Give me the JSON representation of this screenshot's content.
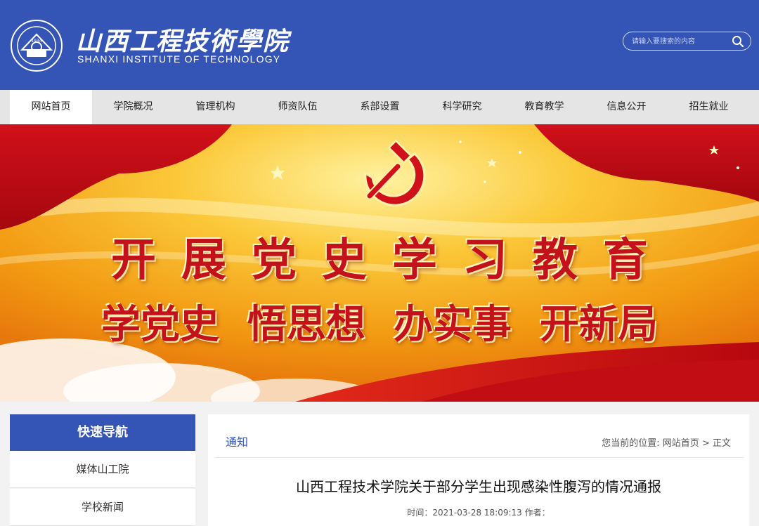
{
  "header": {
    "title_cn": "山西工程技術學院",
    "title_en": "SHANXI INSTITUTE OF TECHNOLOGY",
    "seal_year": "1934",
    "search_placeholder": "请输入要搜索的内容",
    "search_icon": "search-icon"
  },
  "nav": {
    "items": [
      "网站首页",
      "学院概况",
      "管理机构",
      "师资队伍",
      "系部设置",
      "科学研究",
      "教育教学",
      "信息公开",
      "招生就业"
    ],
    "active_index": 0
  },
  "banner": {
    "emblem": "hammer-sickle-icon",
    "title": "开展党史学习教育",
    "subtitles": [
      "学党史",
      "悟思想",
      "办实事",
      "开新局"
    ]
  },
  "sidebar": {
    "heading": "快速导航",
    "items": [
      "媒体山工院",
      "学校新闻"
    ]
  },
  "main": {
    "tab": "通知",
    "breadcrumb": {
      "prefix": "您当前的位置:",
      "home": "网站首页",
      "separator": ">",
      "current": "正文"
    },
    "article": {
      "title": "山西工程技术学院关于部分学生出现感染性腹泻的情况通报",
      "time_label": "时间：",
      "time": "2021-03-28 18:09:13",
      "author_label": "作者："
    }
  },
  "colors": {
    "brand": "#3455b6",
    "nav_bg": "#e5e5e5",
    "banner_red": "#c4121a",
    "banner_gold": "#f6b51e"
  }
}
